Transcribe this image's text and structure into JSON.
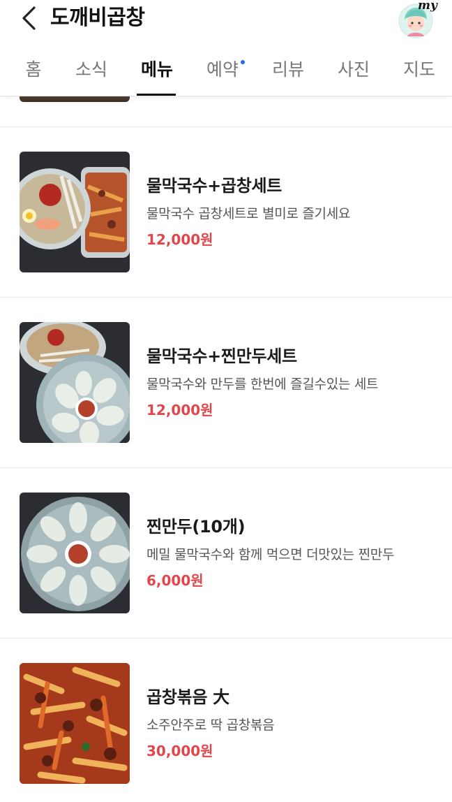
{
  "header": {
    "back_icon": "chevron-left-icon",
    "title": "도깨비곱창",
    "avatar_label": "my",
    "avatar_icon": "user-avatar-icon"
  },
  "tabs": [
    {
      "label": "홈",
      "active": false
    },
    {
      "label": "소식",
      "active": false
    },
    {
      "label": "메뉴",
      "active": true
    },
    {
      "label": "예약",
      "active": false,
      "dot": true
    },
    {
      "label": "리뷰",
      "active": false
    },
    {
      "label": "사진",
      "active": false
    },
    {
      "label": "지도",
      "active": false
    }
  ],
  "colors": {
    "price": "#e0474c",
    "tab_dot": "#1f6cf0",
    "active_tab": "#111111"
  },
  "menu": {
    "items": [
      {
        "name": "물막국수+곱창세트",
        "description": "물막국수 곱창세트로 별미로 즐기세요",
        "price": "12,000원"
      },
      {
        "name": "물막국수+찐만두세트",
        "description": "물막국수와 만두를 한번에 즐길수있는 세트",
        "price": "12,000원"
      },
      {
        "name": "찐만두(10개)",
        "description": "메밀 물막국수와 함께 먹으면 더맛있는 찐만두",
        "price": "6,000원"
      },
      {
        "name": "곱창볶음 大",
        "description": "소주안주로 딱 곱창볶음",
        "price": "30,000원"
      }
    ]
  }
}
